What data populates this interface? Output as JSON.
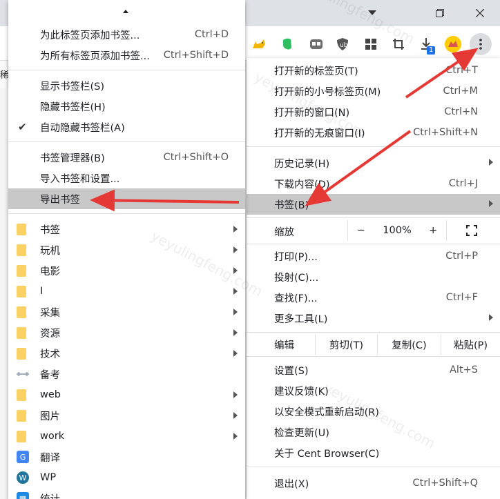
{
  "window": {
    "tab_dropdown_icon": "chevron-down-icon",
    "restore_icon": "restore-icon",
    "close_icon": "close-icon"
  },
  "toolbar": {
    "extensions": [
      "cat-extension-icon",
      "evernote-icon",
      "tab-manager-icon",
      "ublock-icon",
      "grid-apps-icon",
      "crop-icon",
      "download-icon",
      "avatar-icon"
    ],
    "download_badge": "1",
    "menu_icon": "three-dots-icon"
  },
  "page": {
    "sliver_text": "稀"
  },
  "menu": {
    "items_top": [
      {
        "label": "打开新的标签页(T)",
        "shortcut": "Ctrl+T"
      },
      {
        "label": "打开新的小号标签页(M)",
        "shortcut": "Ctrl+M"
      },
      {
        "label": "打开新的窗口(N)",
        "shortcut": "Ctrl+N"
      },
      {
        "label": "打开新的无痕窗口(I)",
        "shortcut": "Ctrl+Shift+N"
      }
    ],
    "history": "历史记录(H)",
    "downloads": {
      "label": "下载内容(D)",
      "shortcut": "Ctrl+J"
    },
    "bookmarks": "书签(B)",
    "zoom": {
      "label": "缩放",
      "minus": "−",
      "value": "100%",
      "plus": "+"
    },
    "print": {
      "label": "打印(P)...",
      "shortcut": "Ctrl+P"
    },
    "cast": "投射(C)...",
    "find": {
      "label": "查找(F)...",
      "shortcut": "Ctrl+F"
    },
    "more_tools": "更多工具(L)",
    "edit": {
      "label": "编辑",
      "cut": "剪切(T)",
      "copy": "复制(C)",
      "paste": "粘贴(P)"
    },
    "settings": {
      "label": "设置(S)",
      "shortcut": "Alt+S"
    },
    "feedback": "建议反馈(K)",
    "safe_restart": "以安全模式重新启动(R)",
    "check_update": "检查更新(U)",
    "about": "关于 Cent Browser(C)",
    "exit": {
      "label": "退出(X)",
      "shortcut": "Ctrl+Shift+Q"
    }
  },
  "bookmarks_menu": {
    "add_this": {
      "label": "为此标签页添加书签...",
      "shortcut": "Ctrl+D"
    },
    "add_all": {
      "label": "为所有标签页添加书签...",
      "shortcut": "Ctrl+Shift+D"
    },
    "show_bar": "显示书签栏(S)",
    "hide_bar": "隐藏书签栏(H)",
    "auto_hide": "自动隐藏书签栏(A)",
    "manager": {
      "label": "书签管理器(B)",
      "shortcut": "Ctrl+Shift+O"
    },
    "import": "导入书签和设置...",
    "export": "导出书签",
    "folders": [
      "书签",
      "玩机",
      "电影",
      "I",
      "采集",
      "资源",
      "技术"
    ],
    "site_beikao": "备考",
    "folders2": [
      "web",
      "图片",
      "work"
    ],
    "site_translate": "翻译",
    "site_wp": "WP",
    "site_stats": "统计"
  },
  "watermark": "yeyulingfeng.com",
  "colors": {
    "highlight": "#c8c8c8",
    "folder": "#fad165",
    "arrow": "#e53935",
    "badge": "#1a73e8"
  }
}
